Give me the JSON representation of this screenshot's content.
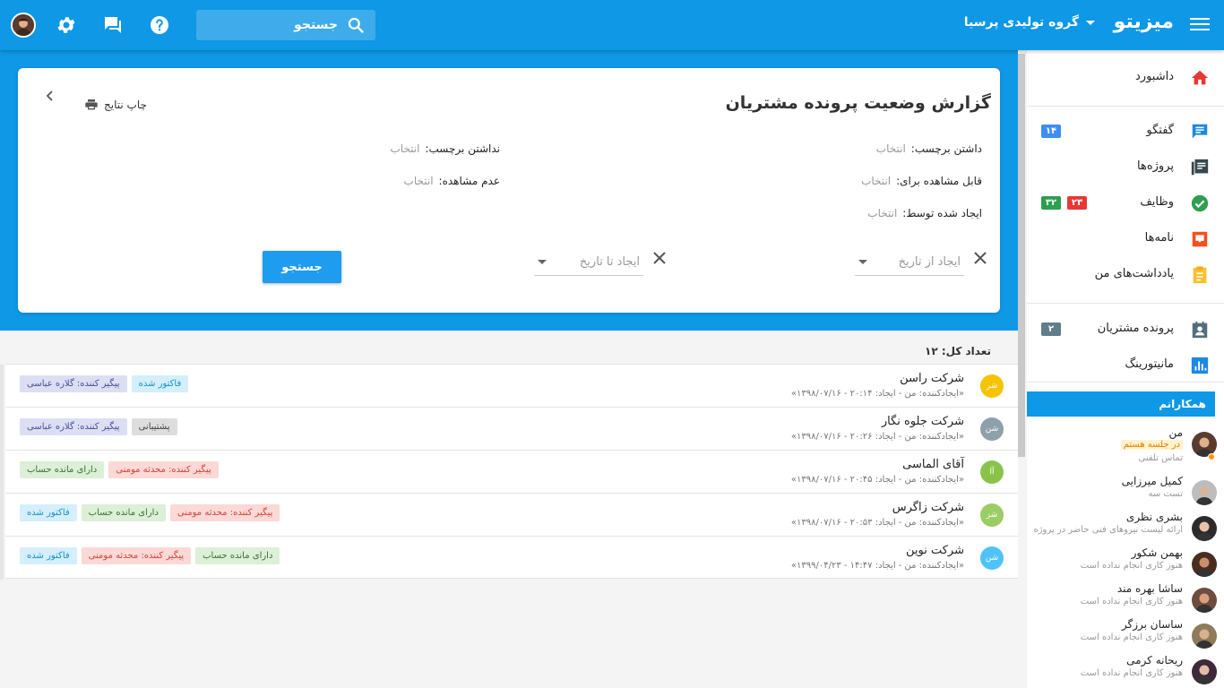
{
  "topbar": {
    "brand": "میزیتو",
    "org": "گروه تولیدی پرسیا",
    "search_placeholder": "جستجو"
  },
  "card": {
    "title": "گزارش وضعیت پرونده مشتریان",
    "print_label": "چاپ نتایج",
    "fields": {
      "has_label": {
        "label": "داشتن برچسب:",
        "value": "انتخاب"
      },
      "no_label": {
        "label": "نداشتن برچسب:",
        "value": "انتخاب"
      },
      "visible_for": {
        "label": "قابل مشاهده برای:",
        "value": "انتخاب"
      },
      "not_visible": {
        "label": "عدم مشاهده:",
        "value": "انتخاب"
      },
      "created_by": {
        "label": "ایجاد شده توسط:",
        "value": "انتخاب"
      }
    },
    "date_from_placeholder": "ایجاد از تاریخ",
    "date_to_placeholder": "ایجاد تا تاریخ",
    "search_button": "جستجو"
  },
  "list": {
    "count_label": "تعداد کل: ۱۲",
    "rows": [
      {
        "name": "شرکت راسن",
        "initials": "شر",
        "avatar_color": "#f5c400",
        "meta": "«ایجادکننده: من - ایجاد: ۲۰:۱۴ - ۱۳۹۸/۰۷/۱۶»",
        "tags": [
          {
            "text": "پیگیر کننده: گلاره عباسی",
            "style": "t-purple"
          },
          {
            "text": "فاکتور شده",
            "style": "t-blue"
          }
        ]
      },
      {
        "name": "شرکت جلوه نگار",
        "initials": "شن",
        "avatar_color": "#8ea0aa",
        "meta": "«ایجادکننده: من - ایجاد: ۲۰:۲۶ - ۱۳۹۸/۰۷/۱۶»",
        "tags": [
          {
            "text": "پیگیر کننده: گلاره عباسی",
            "style": "t-purple"
          },
          {
            "text": "پشتیبانی",
            "style": "t-grey"
          }
        ]
      },
      {
        "name": "آقای الماسی",
        "initials": "آا",
        "avatar_color": "#8bc34a",
        "meta": "«ایجادکننده: من - ایجاد: ۲۰:۴۵ - ۱۳۹۸/۰۷/۱۶»",
        "tags": [
          {
            "text": "دارای مانده حساب",
            "style": "t-green"
          },
          {
            "text": "پیگیر کننده: محدثه مومنی",
            "style": "t-red"
          }
        ]
      },
      {
        "name": "شرکت زاگرس",
        "initials": "شز",
        "avatar_color": "#9ccc65",
        "meta": "«ایجادکننده: من - ایجاد: ۲۰:۵۳ - ۱۳۹۸/۰۷/۱۶»",
        "tags": [
          {
            "text": "فاکتور شده",
            "style": "t-blue"
          },
          {
            "text": "دارای مانده حساب",
            "style": "t-green"
          },
          {
            "text": "پیگیر کننده: محدثه مومنی",
            "style": "t-red"
          }
        ]
      },
      {
        "name": "شرکت نوین",
        "initials": "شن",
        "avatar_color": "#4fc3f7",
        "meta": "«ایجادکننده: من - ایجاد: ۱۴:۴۷ - ۱۳۹۹/۰۴/۲۳»",
        "tags": [
          {
            "text": "فاکتور شده",
            "style": "t-blue"
          },
          {
            "text": "پیگیر کننده: محدثه مومنی",
            "style": "t-red"
          },
          {
            "text": "دارای مانده حساب",
            "style": "t-green"
          }
        ]
      }
    ]
  },
  "sidebar": {
    "nav": [
      {
        "label": "داشبورد",
        "icon": "home-icon"
      },
      {
        "label": "گفتگو",
        "icon": "chat-icon",
        "badges": [
          {
            "text": "۱۴",
            "color": "#3d8ef0"
          }
        ]
      },
      {
        "label": "پروژه‌ها",
        "icon": "projects-icon"
      },
      {
        "label": "وظایف",
        "icon": "tasks-icon",
        "badges": [
          {
            "text": "۳۲",
            "color": "#2e9e4f"
          },
          {
            "text": "۲۳",
            "color": "#e53935"
          }
        ]
      },
      {
        "label": "نامه‌ها",
        "icon": "letters-icon"
      },
      {
        "label": "یادداشت‌های من",
        "icon": "notes-icon"
      },
      {
        "label": "پرونده مشتریان",
        "icon": "customer-files-icon",
        "badges": [
          {
            "text": "۲",
            "color": "#607d8b"
          }
        ]
      },
      {
        "label": "مانیتورینگ",
        "icon": "monitoring-icon"
      }
    ],
    "colleagues_title": "همکارانم",
    "colleagues": [
      {
        "name": "من",
        "meeting": "در جلسه هستم",
        "status": "تماس تلفنی"
      },
      {
        "name": "کمیل میرزایی",
        "status": "تست سه"
      },
      {
        "name": "بشری نظری",
        "status": "ارائه لیست نیروهای فنی حاضر در پروژه"
      },
      {
        "name": "بهمن شکور",
        "status": "هنوز کاری انجام نداده است"
      },
      {
        "name": "ساشا بهره مند",
        "status": "هنوز کاری انجام نداده است"
      },
      {
        "name": "ساسان برزگر",
        "status": "هنوز کاری انجام نداده است"
      },
      {
        "name": "ریحانه کرمی",
        "status": "هنوز کاری انجام نداده است"
      }
    ]
  }
}
